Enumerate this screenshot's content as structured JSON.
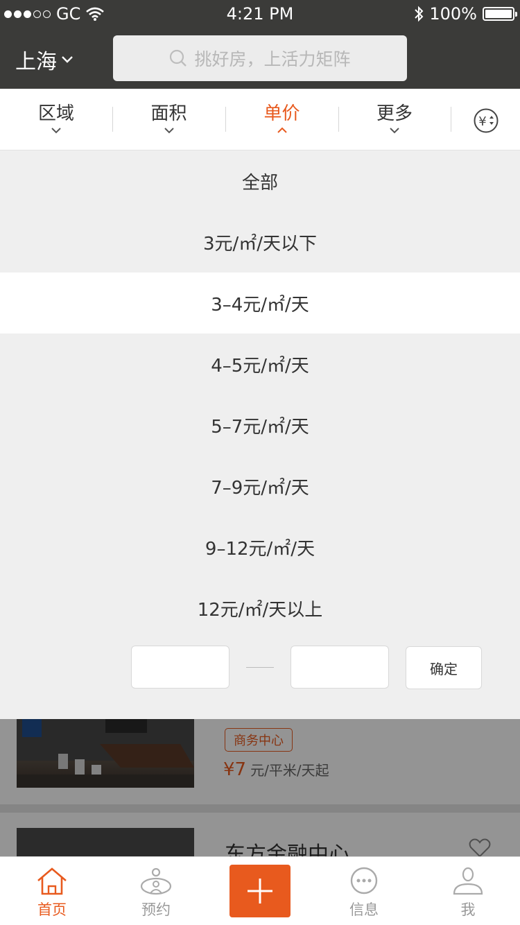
{
  "status_bar": {
    "carrier": "GC",
    "time": "4:21 PM",
    "battery": "100%"
  },
  "header": {
    "city": "上海",
    "search_placeholder": "挑好房，上活力矩阵"
  },
  "filters": [
    {
      "label": "区域",
      "active": false
    },
    {
      "label": "面积",
      "active": false
    },
    {
      "label": "单价",
      "active": true
    },
    {
      "label": "更多",
      "active": false
    }
  ],
  "price_options": [
    {
      "label": "全部",
      "selected": false
    },
    {
      "label": "3元/㎡/天以下",
      "selected": false
    },
    {
      "label": "3–4元/㎡/天",
      "selected": true
    },
    {
      "label": "4–5元/㎡/天",
      "selected": false
    },
    {
      "label": "5–7元/㎡/天",
      "selected": false
    },
    {
      "label": "7–9元/㎡/天",
      "selected": false
    },
    {
      "label": "9–12元/㎡/天",
      "selected": false
    },
    {
      "label": "12元/㎡/天以上",
      "selected": false
    }
  ],
  "range": {
    "min_value": "",
    "max_value": "",
    "confirm_label": "确定"
  },
  "listings": [
    {
      "tag": "商务中心",
      "price": "¥7",
      "price_unit": "元/平米/天起"
    },
    {
      "title": "东方金融中心"
    }
  ],
  "tabbar": [
    {
      "label": "首页",
      "active": true
    },
    {
      "label": "预约",
      "active": false
    },
    {
      "label": "",
      "active": false
    },
    {
      "label": "信息",
      "active": false
    },
    {
      "label": "我",
      "active": false
    }
  ],
  "colors": {
    "accent": "#e85a1e",
    "header_bg": "#3b3b39",
    "dropdown_bg": "#efefef"
  }
}
